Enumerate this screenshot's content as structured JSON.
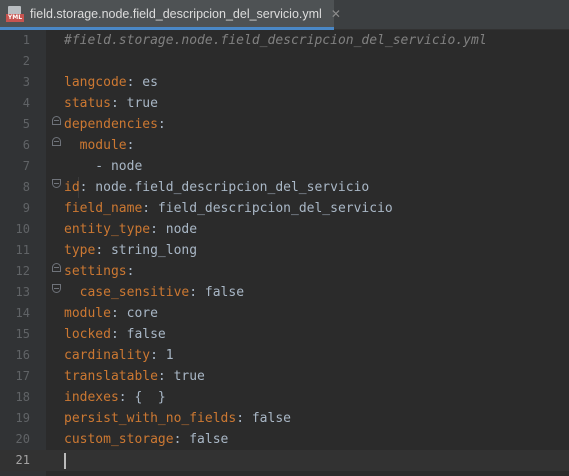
{
  "tab": {
    "icon_text": "YML",
    "title": "field.storage.node.field_descripcion_del_servicio.yml",
    "close_glyph": "✕"
  },
  "editor": {
    "lines": [
      {
        "num": "1",
        "tokens": [
          {
            "t": "#field.storage.node.field_",
            "c": "c"
          },
          {
            "t": "descripcion",
            "c": "c squig"
          },
          {
            "t": "_del_",
            "c": "c"
          },
          {
            "t": "servicio",
            "c": "c squig"
          },
          {
            "t": ".yml",
            "c": "c"
          }
        ]
      },
      {
        "num": "2",
        "tokens": []
      },
      {
        "num": "3",
        "tokens": [
          {
            "t": "langcode",
            "c": "k"
          },
          {
            "t": ": es",
            "c": "v"
          }
        ]
      },
      {
        "num": "4",
        "tokens": [
          {
            "t": "status",
            "c": "k"
          },
          {
            "t": ": true",
            "c": "v"
          }
        ]
      },
      {
        "num": "5",
        "tokens": [
          {
            "t": "dependencies",
            "c": "k"
          },
          {
            "t": ":",
            "c": "v"
          }
        ]
      },
      {
        "num": "6",
        "tokens": [
          {
            "t": "  module",
            "c": "k"
          },
          {
            "t": ":",
            "c": "v"
          }
        ]
      },
      {
        "num": "7",
        "tokens": [
          {
            "t": "    - node",
            "c": "v"
          }
        ]
      },
      {
        "num": "8",
        "tokens": [
          {
            "t": "id",
            "c": "k"
          },
          {
            "t": ": node.field_descripcion_del_servicio",
            "c": "v"
          }
        ]
      },
      {
        "num": "9",
        "tokens": [
          {
            "t": "field_name",
            "c": "k"
          },
          {
            "t": ": field_descripcion_del_servicio",
            "c": "v"
          }
        ]
      },
      {
        "num": "10",
        "tokens": [
          {
            "t": "entity_type",
            "c": "k"
          },
          {
            "t": ": node",
            "c": "v"
          }
        ]
      },
      {
        "num": "11",
        "tokens": [
          {
            "t": "type",
            "c": "k"
          },
          {
            "t": ": string_long",
            "c": "v"
          }
        ]
      },
      {
        "num": "12",
        "tokens": [
          {
            "t": "settings",
            "c": "k"
          },
          {
            "t": ":",
            "c": "v"
          }
        ]
      },
      {
        "num": "13",
        "tokens": [
          {
            "t": "  case_sensitive",
            "c": "k"
          },
          {
            "t": ": false",
            "c": "v"
          }
        ]
      },
      {
        "num": "14",
        "tokens": [
          {
            "t": "module",
            "c": "k"
          },
          {
            "t": ": core",
            "c": "v"
          }
        ]
      },
      {
        "num": "15",
        "tokens": [
          {
            "t": "locked",
            "c": "k"
          },
          {
            "t": ": false",
            "c": "v"
          }
        ]
      },
      {
        "num": "16",
        "tokens": [
          {
            "t": "cardinality",
            "c": "k"
          },
          {
            "t": ": 1",
            "c": "v"
          }
        ]
      },
      {
        "num": "17",
        "tokens": [
          {
            "t": "translatable",
            "c": "k"
          },
          {
            "t": ": true",
            "c": "v"
          }
        ]
      },
      {
        "num": "18",
        "tokens": [
          {
            "t": "indexes",
            "c": "k"
          },
          {
            "t": ": {  }",
            "c": "v"
          }
        ]
      },
      {
        "num": "19",
        "tokens": [
          {
            "t": "persist_with_no_fields",
            "c": "k"
          },
          {
            "t": ": false",
            "c": "v"
          }
        ]
      },
      {
        "num": "20",
        "tokens": [
          {
            "t": "custom_storage",
            "c": "k"
          },
          {
            "t": ": false",
            "c": "v"
          }
        ]
      },
      {
        "num": "21",
        "tokens": [],
        "current": true
      }
    ]
  },
  "colors": {
    "background": "#2b2b2b",
    "gutter": "#313335",
    "key": "#cc7832",
    "value": "#a9b7c6",
    "comment": "#808080",
    "line_number": "#606366",
    "tab_accent": "#4a88c7"
  }
}
